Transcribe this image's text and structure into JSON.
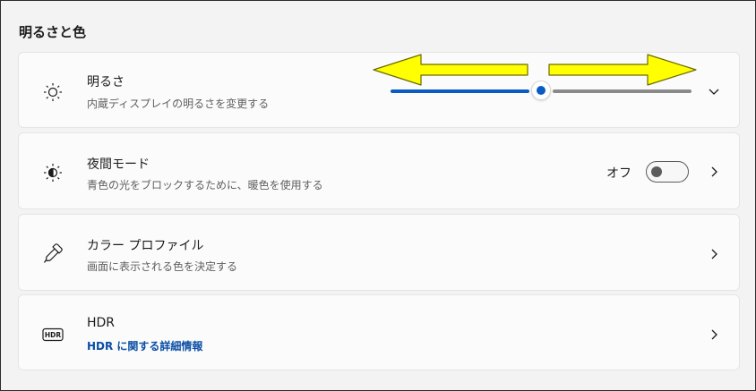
{
  "section": {
    "title": "明るさと色"
  },
  "brightness": {
    "title": "明るさ",
    "description": "内蔵ディスプレイの明るさを変更する",
    "level_percent": 50,
    "icon": "brightness-sun-icon",
    "expand_icon": "chevron-down-icon"
  },
  "night_light": {
    "title": "夜間モード",
    "description": "青色の光をブロックするために、暖色を使用する",
    "toggle_label": "オフ",
    "toggle_on": false,
    "icon": "night-light-icon",
    "nav_icon": "chevron-right-icon"
  },
  "color_profile": {
    "title": "カラー プロファイル",
    "description": "画面に表示される色を決定する",
    "icon": "eyedropper-icon",
    "nav_icon": "chevron-right-icon"
  },
  "hdr": {
    "title": "HDR",
    "link": "HDR に関する詳細情報",
    "icon": "hdr-icon",
    "nav_icon": "chevron-right-icon"
  },
  "annotation": {
    "color": "#ffff00",
    "left_arrow": "arrow-left-icon",
    "right_arrow": "arrow-right-icon"
  },
  "colors": {
    "accent": "#0a5cc2",
    "link": "#0b4fa6"
  }
}
